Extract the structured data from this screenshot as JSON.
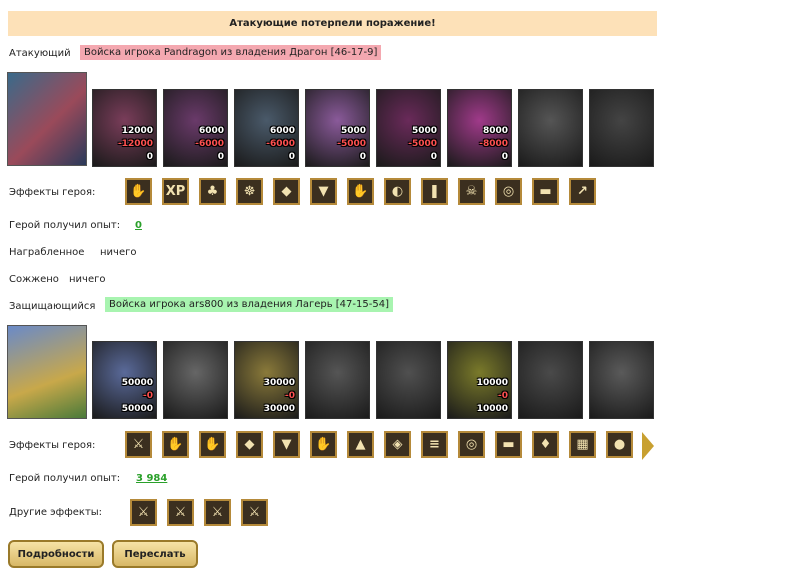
{
  "banner": {
    "text": "Атакующие потерпели поражение!"
  },
  "attacker": {
    "label": "Атакующий",
    "army": "Войска игрока Pandragon из владения Драгон [46-17-9]",
    "units": [
      {
        "n1": "12000",
        "n2": "-12000",
        "n3": "0",
        "color": "#7a3d5a"
      },
      {
        "n1": "6000",
        "n2": "-6000",
        "n3": "0",
        "color": "#6a3a6a"
      },
      {
        "n1": "6000",
        "n2": "-6000",
        "n3": "0",
        "color": "#4a5a6a"
      },
      {
        "n1": "5000",
        "n2": "-5000",
        "n3": "0",
        "color": "#8a5a9a"
      },
      {
        "n1": "5000",
        "n2": "-5000",
        "n3": "0",
        "color": "#6a2a5a"
      },
      {
        "n1": "8000",
        "n2": "-8000",
        "n3": "0",
        "color": "#a03a8a"
      },
      {
        "n1": "",
        "n2": "",
        "n3": "",
        "color": "#555555"
      },
      {
        "n1": "",
        "n2": "",
        "n3": "",
        "color": "#444444"
      }
    ],
    "effects_label": "Эффекты героя:",
    "effects": [
      "✋",
      "XP",
      "♣",
      "☸",
      "◆",
      "▼",
      "✋",
      "◐",
      "❚",
      "☠",
      "◎",
      "▬",
      "↗"
    ],
    "exp_label": "Герой получил опыт:",
    "exp_value": "0",
    "loot_label": "Награбленное",
    "loot_value": "ничего",
    "burnt_label": "Сожжено",
    "burnt_value": "ничего"
  },
  "defender": {
    "label": "Защищающийся",
    "army": "Войска игрока ars800 из владения Лагерь [47-15-54]",
    "units": [
      {
        "n1": "50000",
        "n2": "-0",
        "n3": "50000",
        "color": "#5a6a9a"
      },
      {
        "n1": "",
        "n2": "",
        "n3": "",
        "color": "#666666"
      },
      {
        "n1": "30000",
        "n2": "-0",
        "n3": "30000",
        "color": "#8a7a3a"
      },
      {
        "n1": "",
        "n2": "",
        "n3": "",
        "color": "#555555"
      },
      {
        "n1": "",
        "n2": "",
        "n3": "",
        "color": "#505050"
      },
      {
        "n1": "10000",
        "n2": "-0",
        "n3": "10000",
        "color": "#7a7a2a"
      },
      {
        "n1": "",
        "n2": "",
        "n3": "",
        "color": "#4a4a4a"
      },
      {
        "n1": "",
        "n2": "",
        "n3": "",
        "color": "#5a5a5a"
      }
    ],
    "effects_label": "Эффекты героя:",
    "effects": [
      "⚔",
      "✋",
      "✋",
      "◆",
      "▼",
      "✋",
      "▲",
      "◈",
      "≡",
      "◎",
      "▬",
      "♦",
      "▦",
      "●"
    ],
    "exp_label": "Герой получил опыт:",
    "exp_value": "3 984",
    "other_label": "Другие эффекты:",
    "other_effects": [
      "⚔",
      "⚔",
      "⚔",
      "⚔"
    ]
  },
  "buttons": {
    "details": "Подробности",
    "forward": "Переслать"
  }
}
